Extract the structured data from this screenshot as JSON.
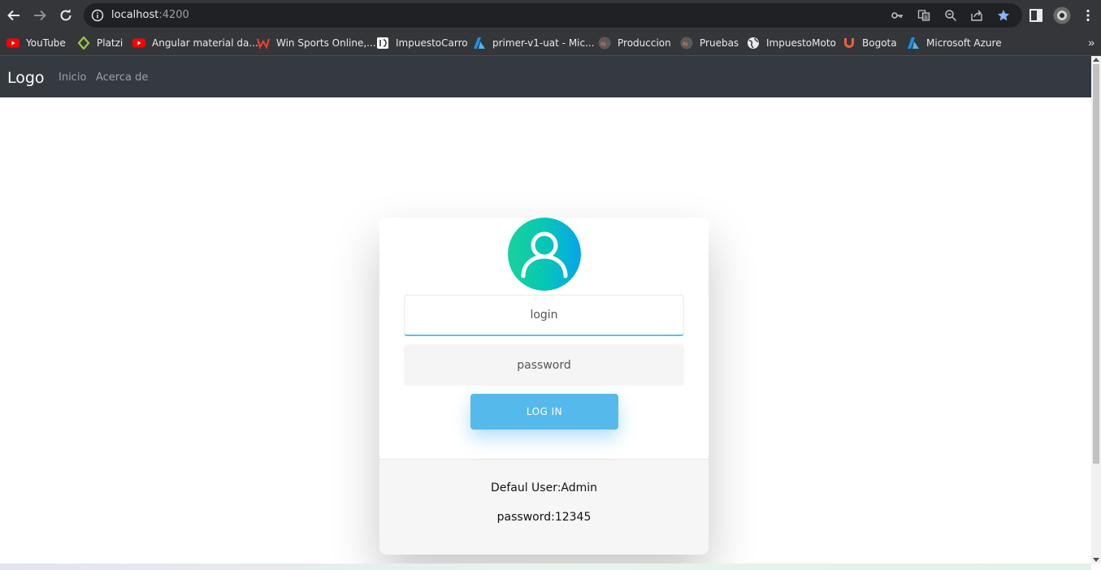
{
  "browser": {
    "url_host": "localhost",
    "url_port": ":4200",
    "bookmarks": [
      {
        "label": "YouTube",
        "icon": "youtube-icon",
        "color": "#ff0000"
      },
      {
        "label": "Platzi",
        "icon": "platzi-icon",
        "color": "#98ca3f"
      },
      {
        "label": "Angular material da...",
        "icon": "youtube-icon",
        "color": "#ff0000"
      },
      {
        "label": "Win Sports Online,...",
        "icon": "winsports-icon",
        "color": "#e8412c"
      },
      {
        "label": "ImpuestoCarro",
        "icon": "impuesto-icon",
        "color": "#ffffff"
      },
      {
        "label": "primer-v1-uat - Mic...",
        "icon": "azure-icon",
        "color": "#1a91e8"
      },
      {
        "label": "Produccion",
        "icon": "produccion-icon",
        "color": "#5a5a5a"
      },
      {
        "label": "Pruebas",
        "icon": "pruebas-icon",
        "color": "#5a5a5a"
      },
      {
        "label": "ImpuestoMoto",
        "icon": "globe-icon",
        "color": "#e8eaed"
      },
      {
        "label": "Bogota",
        "icon": "bogota-icon",
        "color": "#e8623a"
      },
      {
        "label": "Microsoft Azure",
        "icon": "azure-icon",
        "color": "#1a91e8"
      }
    ],
    "more_glyph": "»"
  },
  "navbar": {
    "brand": "Logo",
    "links": [
      "Inicio",
      "Acerca de"
    ]
  },
  "login_form": {
    "login_placeholder": "login",
    "password_placeholder": "password",
    "submit_label": "LOG IN"
  },
  "footer": {
    "default_user": "Defaul User:Admin",
    "default_password": "password:12345"
  },
  "colors": {
    "avatar_gradient": [
      "#19d29a",
      "#05a5ea"
    ],
    "button": "#56b9ec",
    "navbar": "#343a40",
    "star_bookmarked": "#8ab4f8"
  }
}
